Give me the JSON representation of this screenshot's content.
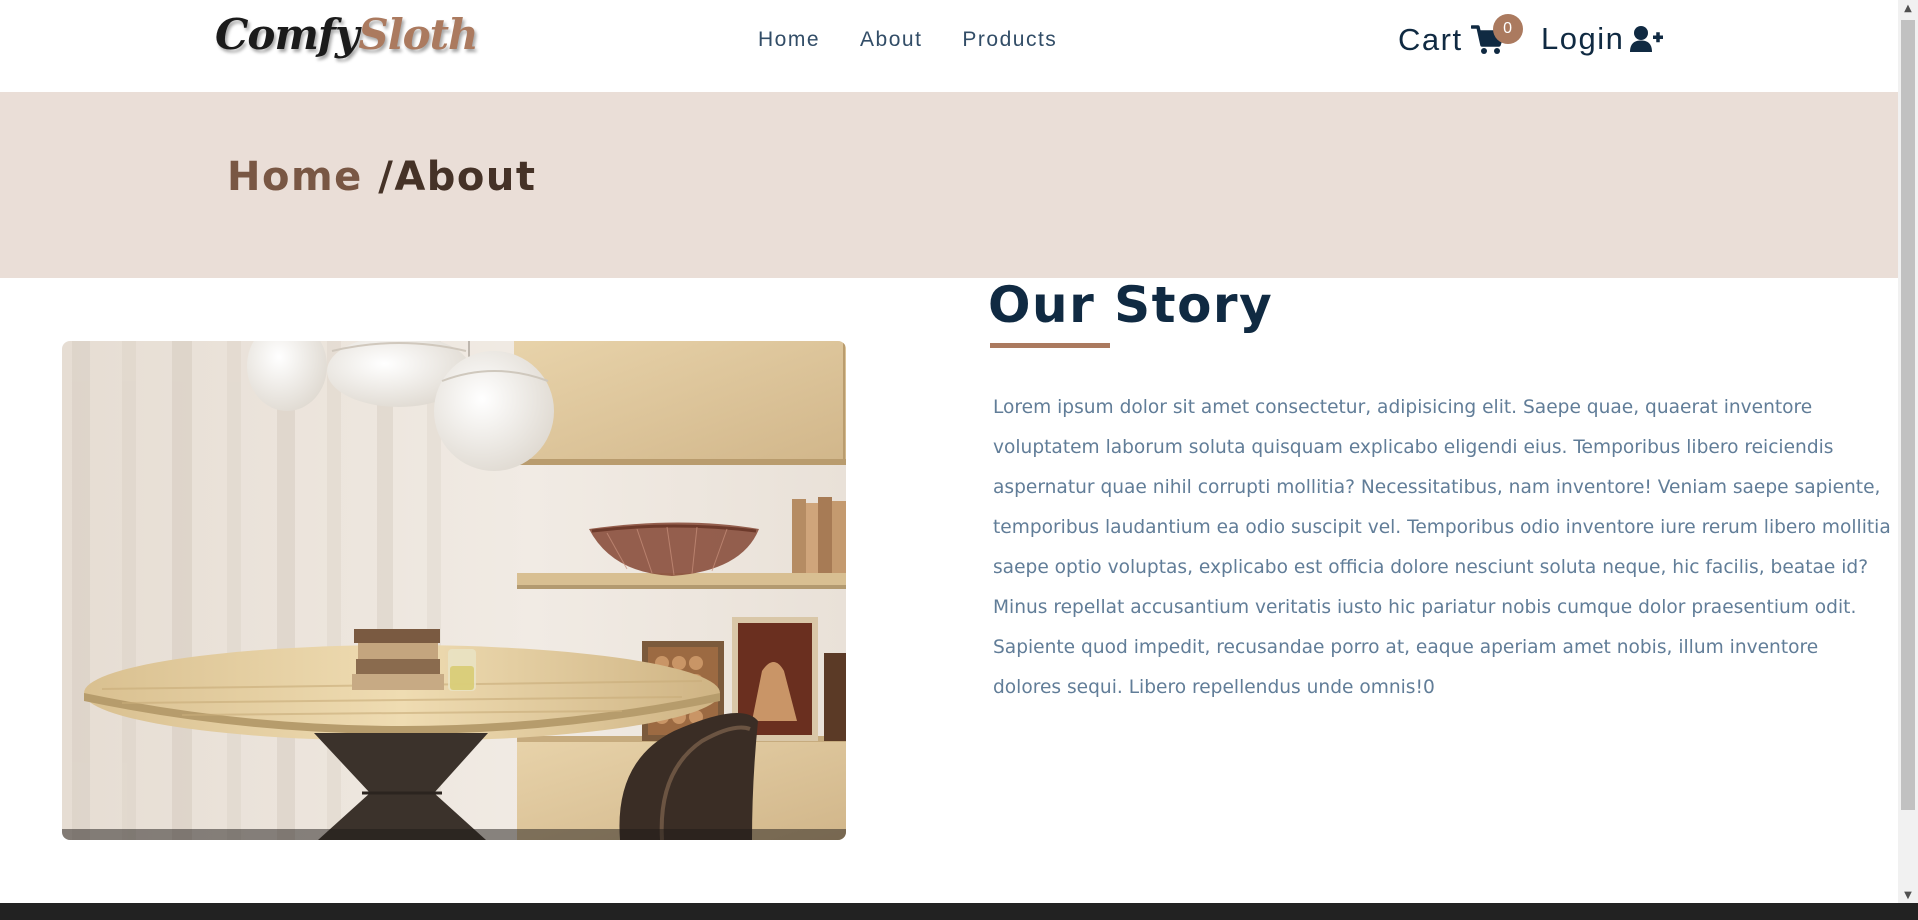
{
  "brand": {
    "logo_part_a": "Comfy",
    "logo_part_b": "Sloth"
  },
  "nav": {
    "links": [
      {
        "label": "Home"
      },
      {
        "label": "About"
      },
      {
        "label": "Products"
      }
    ],
    "cart_label": "Cart",
    "cart_count": "0",
    "login_label": "Login"
  },
  "hero": {
    "crumb_home": "Home",
    "crumb_current": "/About"
  },
  "about": {
    "title": "Our Story",
    "text": "Lorem ipsum dolor sit amet consectetur, adipisicing elit. Saepe quae, quaerat inventore voluptatem laborum soluta quisquam explicabo eligendi eius. Temporibus libero reiciendis aspernatur quae nihil corrupti mollitia? Necessitatibus, nam inventore! Veniam saepe sapiente, temporibus laudantium ea odio suscipit vel. Temporibus odio inventore iure rerum libero mollitia saepe optio voluptas, explicabo est officia dolore nesciunt soluta neque, hic facilis, beatae id? Minus repellat accusantium veritatis iusto hic pariatur nobis cumque dolor praesentium odit. Sapiente quod impedit, recusandae porro at, eaque aperiam amet nobis, illum inventore dolores sequi. Libero repellendus unde omnis!0"
  },
  "colors": {
    "brand_brown": "#ab7a5f",
    "dark_navy": "#102a42",
    "hero_bg": "#eaded7",
    "text_grey_blue": "#617d98"
  },
  "icons": {
    "cart": "shopping-cart-icon",
    "login": "user-plus-icon"
  }
}
